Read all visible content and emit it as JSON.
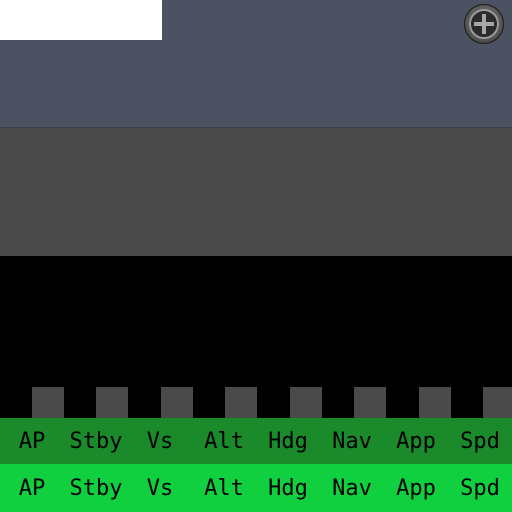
{
  "colors": {
    "top_panel": "#4c5262",
    "mid_panel": "#4a4a4a",
    "black_area": "#000000",
    "indicator_off": "#4a4a4a",
    "row1_green": "#1a8a2a",
    "row2_green": "#10d040",
    "text": "#000000"
  },
  "icons": {
    "zoom": "plus-knob-icon"
  },
  "autopilot": {
    "row1": [
      "AP",
      "Stby",
      "Vs",
      "Alt",
      "Hdg",
      "Nav",
      "App",
      "Spd"
    ],
    "row2": [
      "AP",
      "Stby",
      "Vs",
      "Alt",
      "Hdg",
      "Nav",
      "App",
      "Spd"
    ],
    "indicators_lit": [
      false,
      false,
      false,
      false,
      false,
      false,
      false,
      false
    ]
  }
}
